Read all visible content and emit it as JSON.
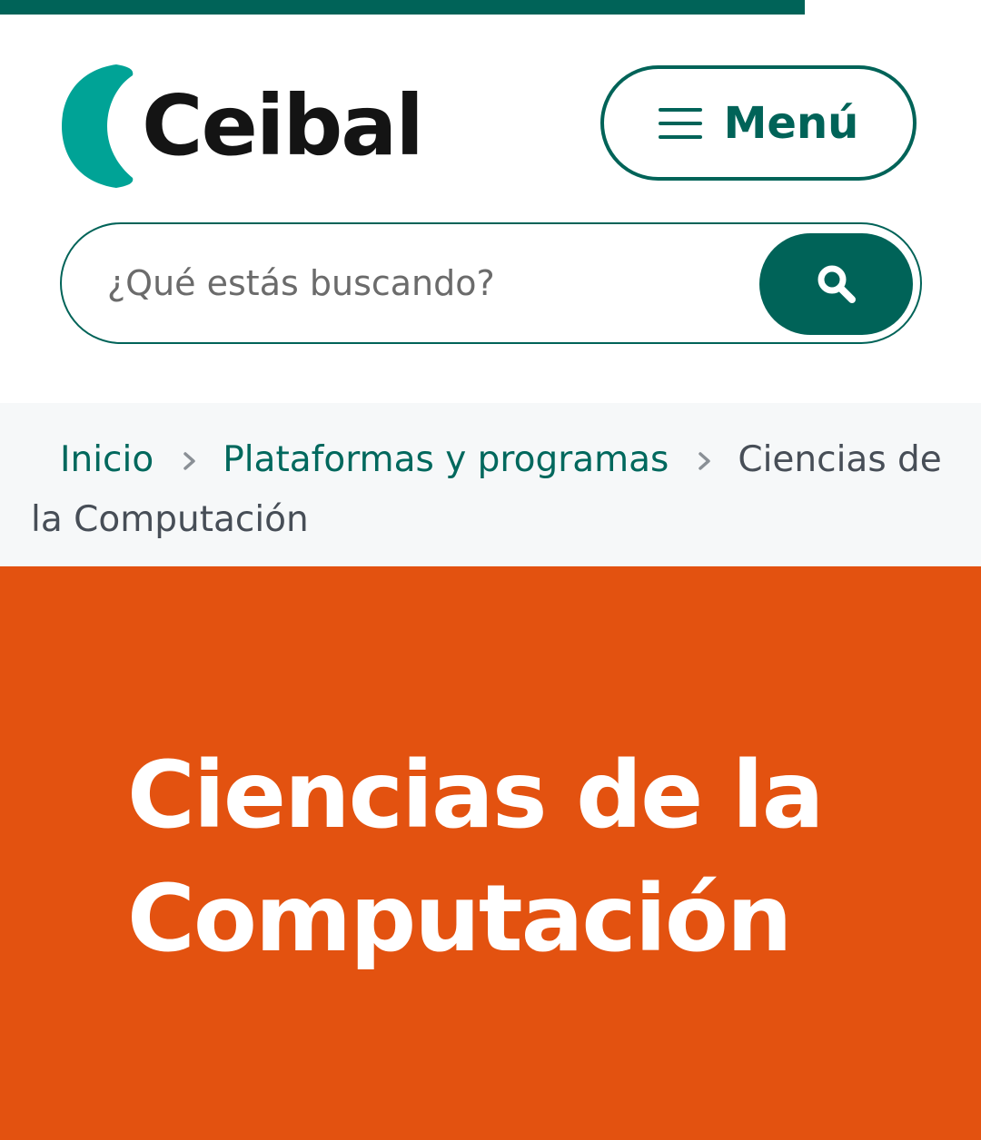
{
  "page_load_progress": 0.82,
  "colors": {
    "brand": "#006358",
    "logo_accent": "#00a396",
    "hero_background": "#e35210",
    "breadcrumb_background": "#f6f8f9"
  },
  "header": {
    "logo_text": "Ceibal",
    "menu_label": "Menú",
    "menu_icon": "hamburger-icon"
  },
  "search": {
    "placeholder": "¿Qué estás buscando?",
    "icon": "search-icon"
  },
  "breadcrumb": {
    "separator_icon": "chevron-right-icon",
    "items": [
      {
        "label": "Inicio"
      },
      {
        "label": "Plataformas y programas"
      },
      {
        "label": "Ciencias de la Computación"
      }
    ]
  },
  "hero": {
    "title": "Ciencias de la Computación"
  }
}
